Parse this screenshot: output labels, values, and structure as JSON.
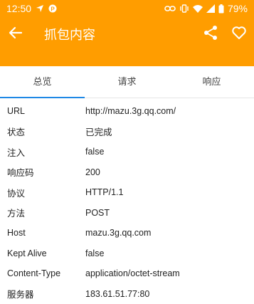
{
  "status_bar": {
    "time": "12:50",
    "battery": "79%"
  },
  "toolbar": {
    "title": "抓包内容"
  },
  "tabs": [
    {
      "label": "总览"
    },
    {
      "label": "请求"
    },
    {
      "label": "响应"
    }
  ],
  "rows": [
    {
      "key": "URL",
      "value": "http://mazu.3g.qq.com/"
    },
    {
      "key": "状态",
      "value": "已完成"
    },
    {
      "key": "注入",
      "value": "false"
    },
    {
      "key": "响应码",
      "value": "200"
    },
    {
      "key": "协议",
      "value": "HTTP/1.1"
    },
    {
      "key": "方法",
      "value": "POST"
    },
    {
      "key": "Host",
      "value": "mazu.3g.qq.com"
    },
    {
      "key": "Kept Alive",
      "value": "false"
    },
    {
      "key": "Content-Type",
      "value": "application/octet-stream"
    },
    {
      "key": "服务器",
      "value": "183.61.51.77:80"
    }
  ]
}
